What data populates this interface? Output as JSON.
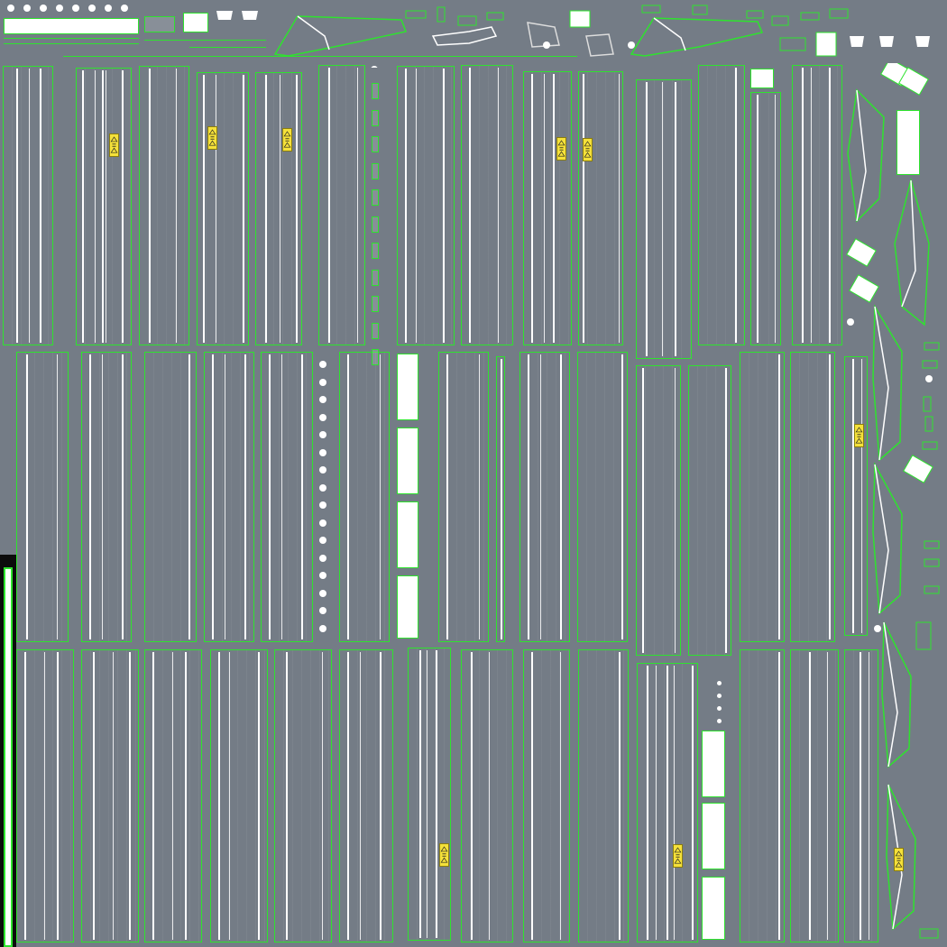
{
  "texture": {
    "kind": "uv-layout",
    "background_color": "#747c86",
    "outline_color": "#2ee32e",
    "fill_color": "#ffffff",
    "label_color": "#f5e13a"
  },
  "warning_labels": [
    {
      "icon": "warning-triangle-icon"
    },
    {
      "icon": "warning-triangle-icon"
    },
    {
      "icon": "warning-triangle-icon"
    },
    {
      "icon": "warning-triangle-icon"
    },
    {
      "icon": "warning-triangle-icon"
    },
    {
      "icon": "warning-triangle-icon"
    },
    {
      "icon": "warning-triangle-icon"
    },
    {
      "icon": "warning-triangle-icon"
    },
    {
      "icon": "warning-triangle-icon"
    }
  ]
}
